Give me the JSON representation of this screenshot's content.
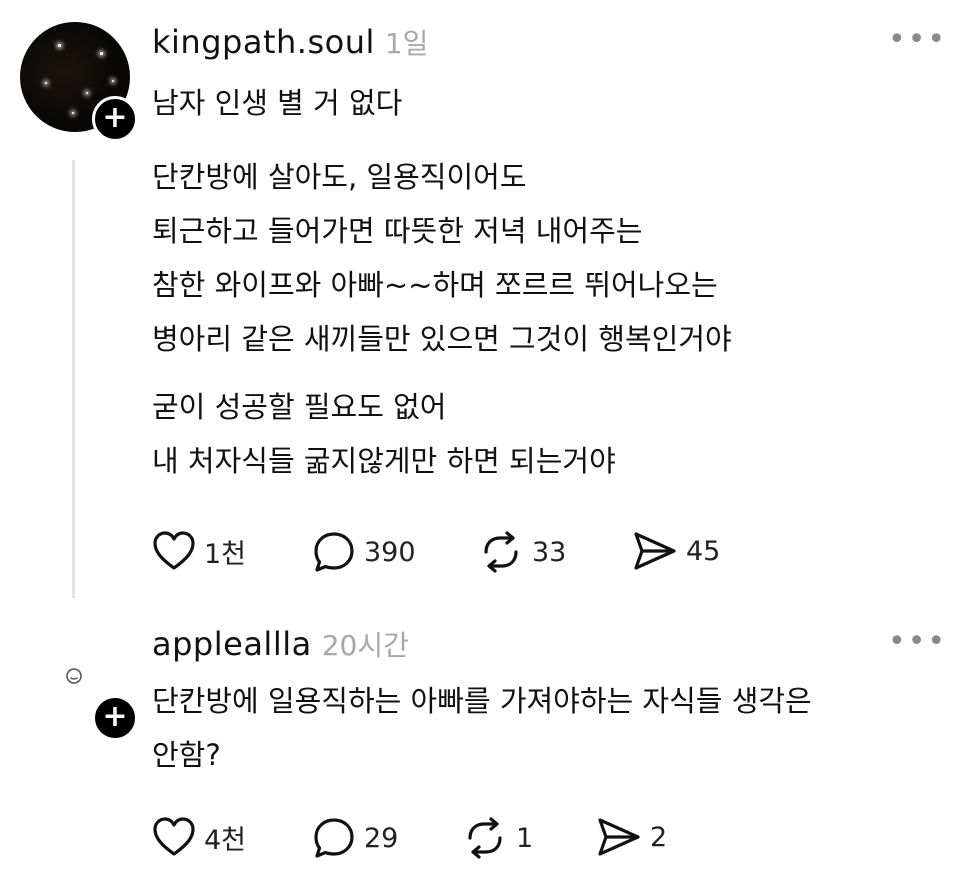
{
  "post": {
    "username": "kingpath.soul",
    "time": "1일",
    "more": "•••",
    "title": "남자 인생 별 거 없다",
    "body_lines": [
      "단칸방에 살아도, 일용직이어도",
      "퇴근하고 들어가면 따뜻한 저녁 내어주는",
      "참한 와이프와 아빠~~하며 쪼르르 뛰어나오는",
      "병아리 같은 새끼들만 있으면 그것이 행복인거야"
    ],
    "body_lines_2": [
      "굳이 성공할 필요도 없어",
      "내 처자식들 굶지않게만 하면 되는거야"
    ],
    "actions": {
      "likes": "1천",
      "comments": "390",
      "reposts": "33",
      "shares": "45"
    }
  },
  "reply": {
    "username": "appleallla",
    "time": "20시간",
    "more": "•••",
    "text_lines": [
      "단칸방에 일용직하는 아빠를 가져야하는 자식들 생각은",
      "안함?"
    ],
    "actions": {
      "likes": "4천",
      "comments": "29",
      "reposts": "1",
      "shares": "2"
    }
  },
  "icons": {
    "like": "heart-icon",
    "comment": "speech-bubble-icon",
    "repost": "repost-arrows-icon",
    "share": "paper-plane-icon",
    "follow": "plus-icon"
  }
}
